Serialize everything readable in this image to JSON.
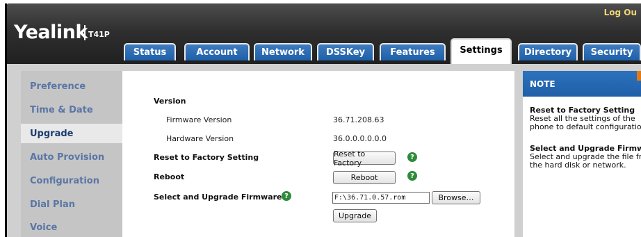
{
  "header": {
    "logo": "Yealink",
    "model": "T41P",
    "logout": "Log Ou"
  },
  "tabs": [
    {
      "label": "Status",
      "active": false
    },
    {
      "label": "Account",
      "active": false
    },
    {
      "label": "Network",
      "active": false
    },
    {
      "label": "DSSKey",
      "active": false
    },
    {
      "label": "Features",
      "active": false
    },
    {
      "label": "Settings",
      "active": true
    },
    {
      "label": "Directory",
      "active": false
    },
    {
      "label": "Security",
      "active": false
    }
  ],
  "sidebar": {
    "items": [
      {
        "label": "Preference"
      },
      {
        "label": "Time & Date"
      },
      {
        "label": "Upgrade",
        "active": true
      },
      {
        "label": "Auto Provision"
      },
      {
        "label": "Configuration"
      },
      {
        "label": "Dial Plan"
      },
      {
        "label": "Voice"
      }
    ]
  },
  "main": {
    "version_title": "Version",
    "firmware_label": "Firmware Version",
    "firmware_value": "36.71.208.63",
    "hardware_label": "Hardware Version",
    "hardware_value": "36.0.0.0.0.0.0",
    "reset_label": "Reset to Factory Setting",
    "reset_button": "Reset to Factory",
    "reboot_label": "Reboot",
    "reboot_button": "Reboot",
    "upgrade_fw_label": "Select and Upgrade Firmware",
    "file_value": "F:\\36.71.0.57.rom",
    "browse_button": "Browse…",
    "upgrade_button": "Upgrade"
  },
  "note": {
    "title": "NOTE",
    "items": [
      {
        "heading": "Reset to Factory Setting",
        "lines": [
          "Reset all the settings of the",
          "phone to default configurations"
        ]
      },
      {
        "heading": "Select and Upgrade Firmware",
        "lines": [
          "Select and upgrade the file from",
          "the hard disk or network."
        ]
      }
    ]
  },
  "colors": {
    "tab_blue": "#1d5fa8",
    "sidebar_link": "#5a76a6",
    "help_green": "#2e8b3a",
    "note_accent": "#e07a12"
  }
}
